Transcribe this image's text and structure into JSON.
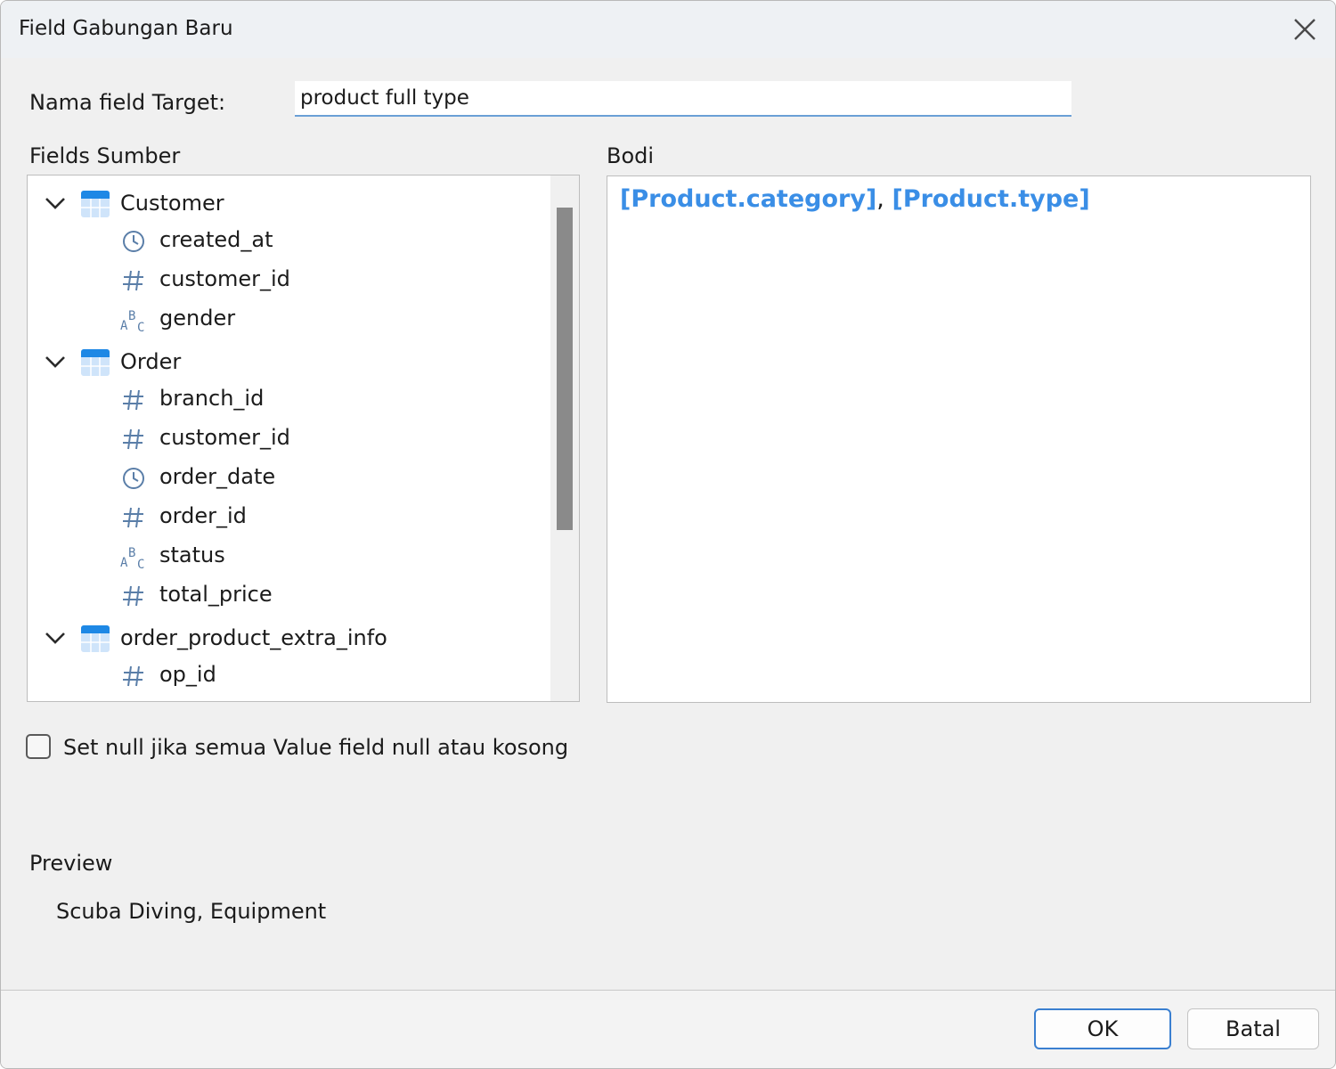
{
  "dialog": {
    "title": "Field Gabungan Baru",
    "close_icon": "close-icon"
  },
  "target": {
    "label": "Nama field Target:",
    "value": "product full type"
  },
  "source": {
    "label": "Fields Sumber",
    "tables": [
      {
        "name": "Customer",
        "expanded": true,
        "fields": [
          {
            "type": "clock",
            "name": "created_at"
          },
          {
            "type": "hash",
            "name": "customer_id"
          },
          {
            "type": "abc",
            "name": "gender"
          }
        ]
      },
      {
        "name": "Order",
        "expanded": true,
        "fields": [
          {
            "type": "hash",
            "name": "branch_id"
          },
          {
            "type": "hash",
            "name": "customer_id"
          },
          {
            "type": "clock",
            "name": "order_date"
          },
          {
            "type": "hash",
            "name": "order_id"
          },
          {
            "type": "abc",
            "name": "status"
          },
          {
            "type": "hash",
            "name": "total_price"
          }
        ]
      },
      {
        "name": "order_product_extra_info",
        "expanded": true,
        "fields": [
          {
            "type": "hash",
            "name": "op_id"
          }
        ]
      }
    ]
  },
  "body": {
    "label": "Bodi",
    "token1": "[Product.category]",
    "separator": ",",
    "token2": "[Product.type]",
    "token_color": "#3a8ee6"
  },
  "options": {
    "null_checkbox_label": "Set null jika semua Value field null atau kosong",
    "null_checkbox_checked": false
  },
  "preview": {
    "label": "Preview",
    "value": "Scuba Diving, Equipment"
  },
  "buttons": {
    "ok": "OK",
    "cancel": "Batal"
  }
}
